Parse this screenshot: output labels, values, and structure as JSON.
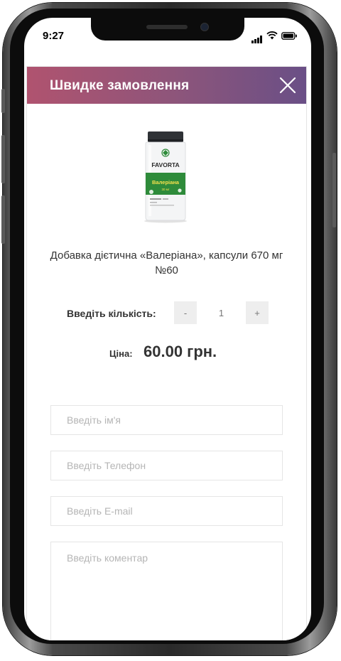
{
  "status_bar": {
    "time": "9:27"
  },
  "modal": {
    "title": "Швидке замовлення",
    "product": {
      "name": "Добавка дієтична «Валеріана», капсули 670 мг №60",
      "image_brand": "FAVORTA",
      "image_label": "Валеріана",
      "image_sublabel": "30 мг"
    },
    "quantity": {
      "label": "Введіть кількість:",
      "minus": "-",
      "value": "1",
      "plus": "+"
    },
    "price": {
      "label": "Ціна:",
      "value": "60.00 грн."
    },
    "form": {
      "name_placeholder": "Введіть ім'я",
      "phone_placeholder": "Введіть Телефон",
      "email_placeholder": "Введіть E-mail",
      "comment_placeholder": "Введіть коментар"
    }
  },
  "colors": {
    "header_gradient_start": "#b0536f",
    "header_gradient_end": "#6a4f86",
    "label_green": "#2e8b3a"
  }
}
